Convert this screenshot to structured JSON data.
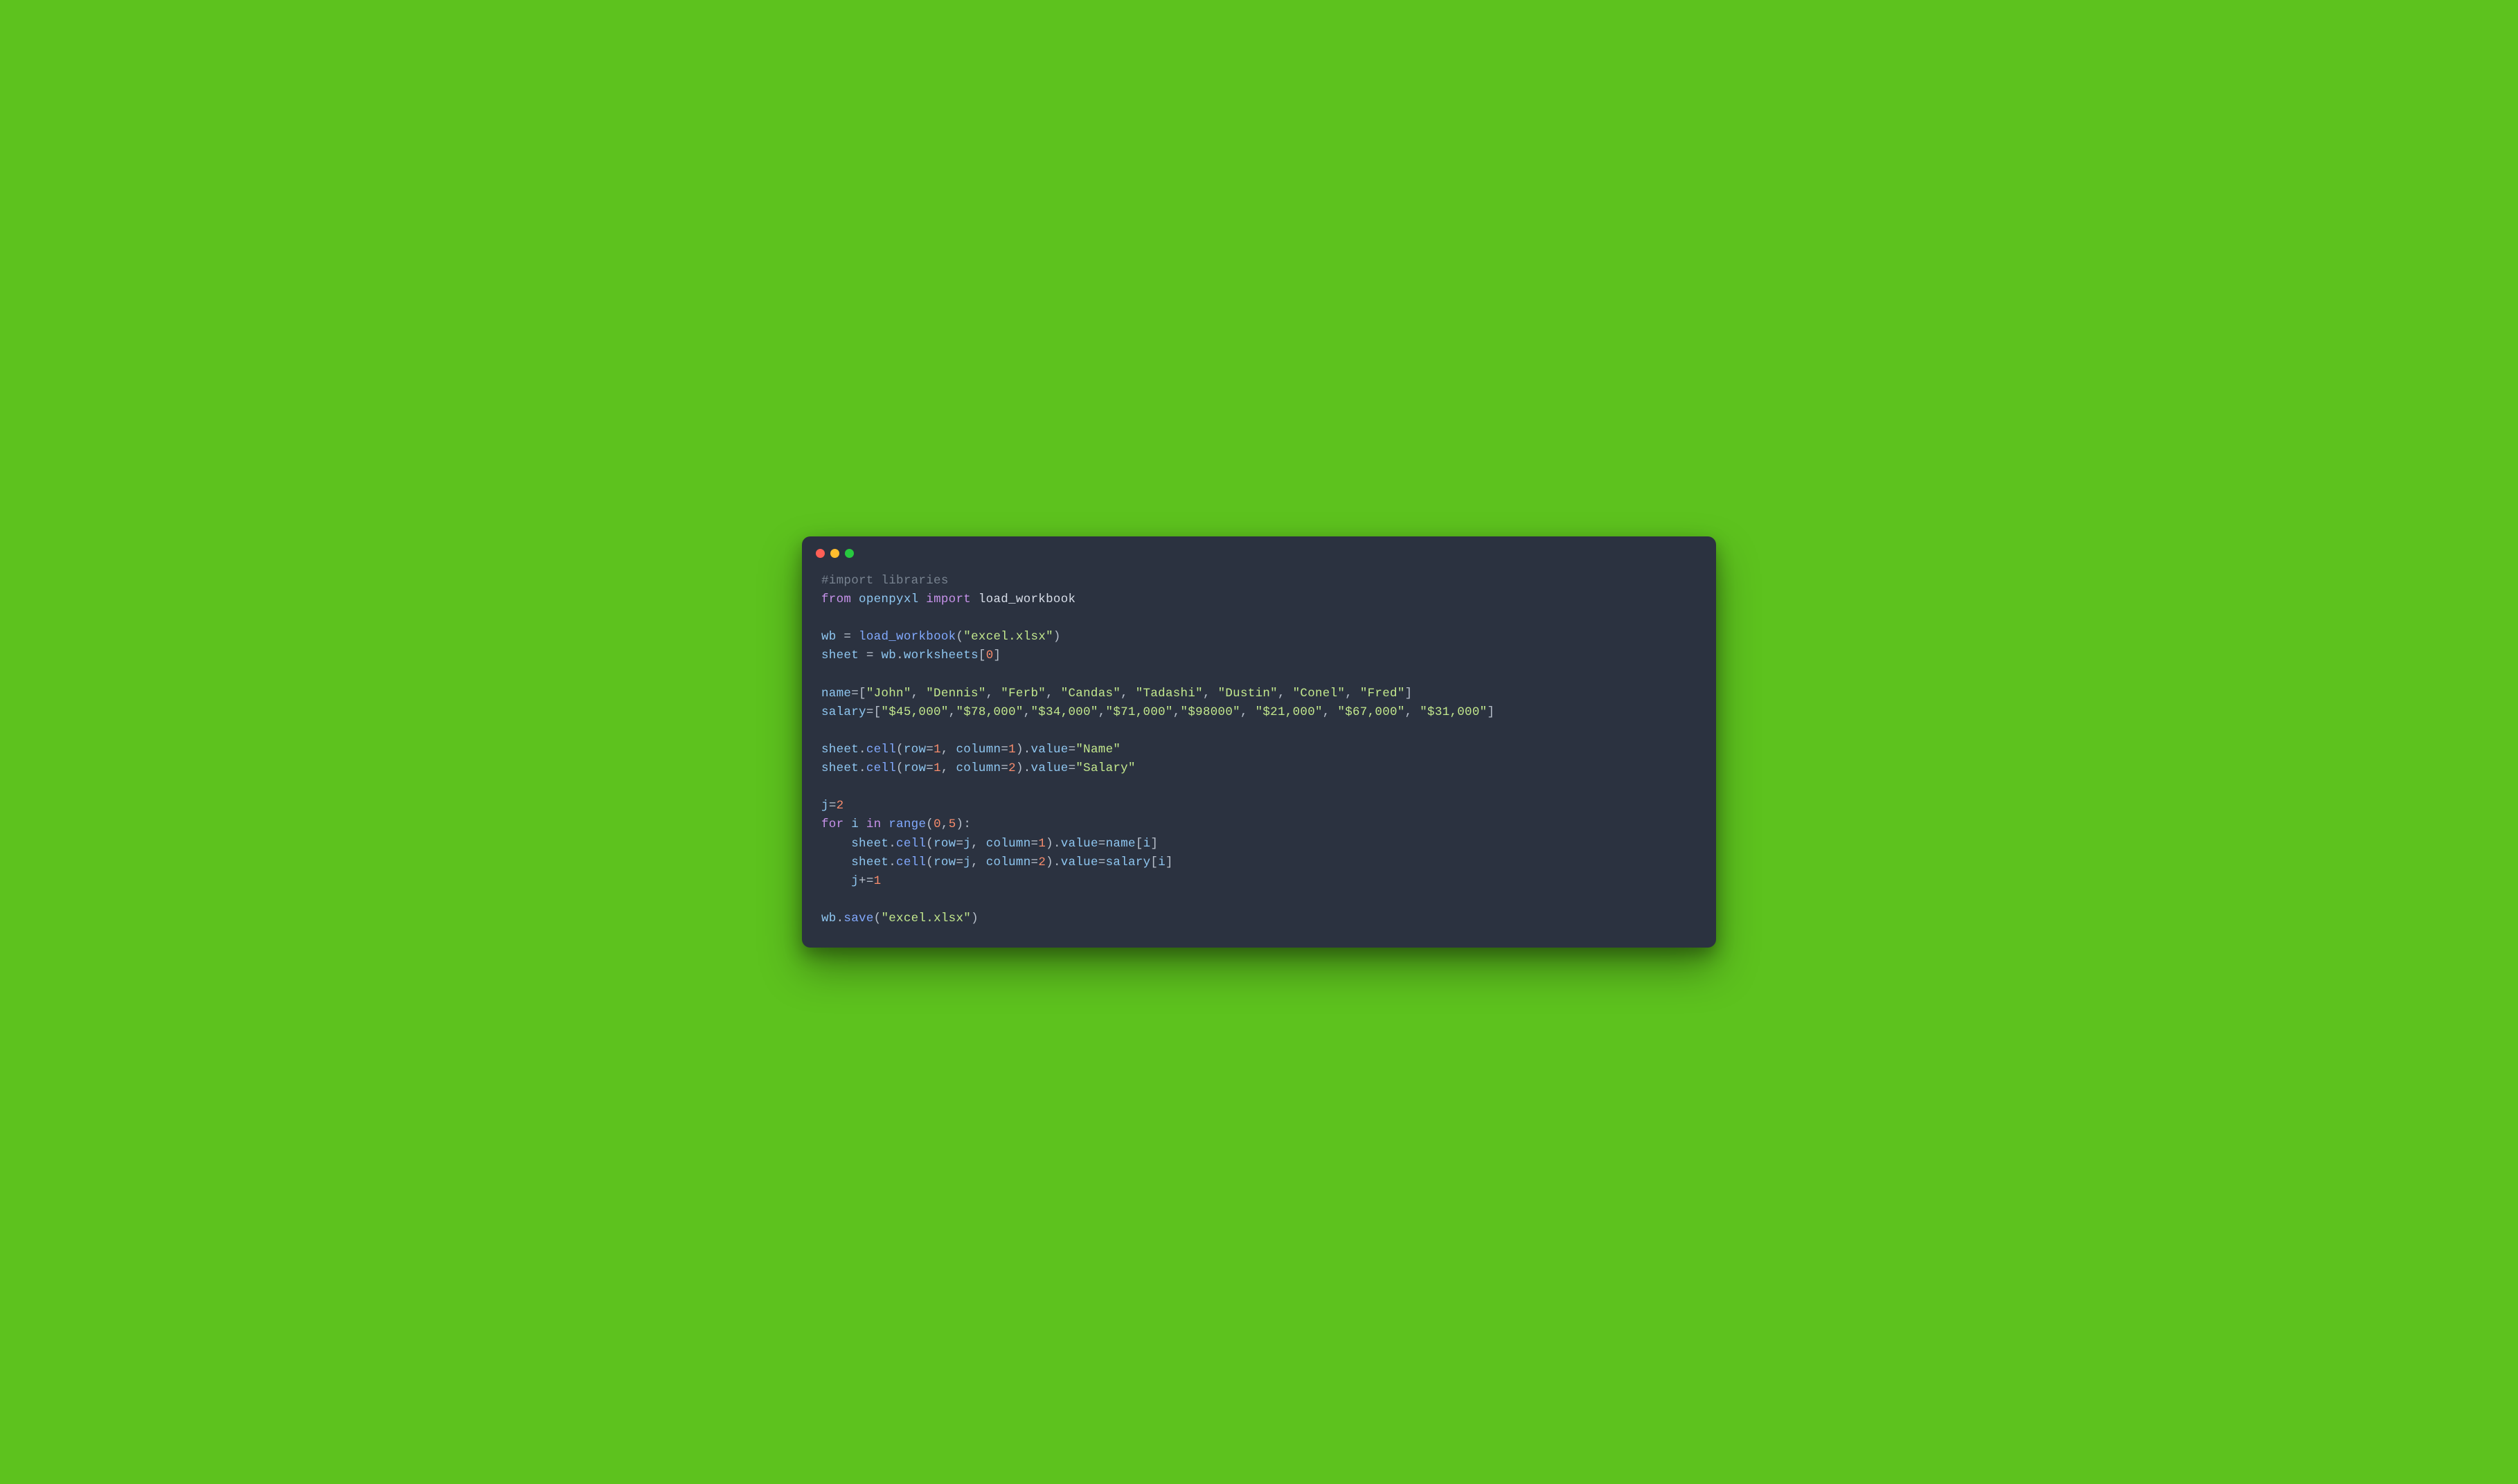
{
  "window": {
    "traffic_lights": [
      "red",
      "yellow",
      "green"
    ]
  },
  "code": {
    "lines": [
      [
        {
          "cls": "comment",
          "t": "#import libraries"
        }
      ],
      [
        {
          "cls": "keyword",
          "t": "from"
        },
        {
          "cls": "default",
          "t": " "
        },
        {
          "cls": "ident",
          "t": "openpyxl"
        },
        {
          "cls": "default",
          "t": " "
        },
        {
          "cls": "keyword",
          "t": "import"
        },
        {
          "cls": "default",
          "t": " load_workbook"
        }
      ],
      [],
      [
        {
          "cls": "ident",
          "t": "wb"
        },
        {
          "cls": "default",
          "t": " "
        },
        {
          "cls": "punct",
          "t": "="
        },
        {
          "cls": "default",
          "t": " "
        },
        {
          "cls": "func",
          "t": "load_workbook"
        },
        {
          "cls": "punct",
          "t": "("
        },
        {
          "cls": "string",
          "t": "\"excel.xlsx\""
        },
        {
          "cls": "punct",
          "t": ")"
        }
      ],
      [
        {
          "cls": "ident",
          "t": "sheet"
        },
        {
          "cls": "default",
          "t": " "
        },
        {
          "cls": "punct",
          "t": "="
        },
        {
          "cls": "default",
          "t": " "
        },
        {
          "cls": "ident",
          "t": "wb"
        },
        {
          "cls": "punct",
          "t": "."
        },
        {
          "cls": "prop",
          "t": "worksheets"
        },
        {
          "cls": "punct",
          "t": "["
        },
        {
          "cls": "number",
          "t": "0"
        },
        {
          "cls": "punct",
          "t": "]"
        }
      ],
      [],
      [
        {
          "cls": "ident",
          "t": "name"
        },
        {
          "cls": "punct",
          "t": "=["
        },
        {
          "cls": "string",
          "t": "\"John\""
        },
        {
          "cls": "punct",
          "t": ", "
        },
        {
          "cls": "string",
          "t": "\"Dennis\""
        },
        {
          "cls": "punct",
          "t": ", "
        },
        {
          "cls": "string",
          "t": "\"Ferb\""
        },
        {
          "cls": "punct",
          "t": ", "
        },
        {
          "cls": "string",
          "t": "\"Candas\""
        },
        {
          "cls": "punct",
          "t": ", "
        },
        {
          "cls": "string",
          "t": "\"Tadashi\""
        },
        {
          "cls": "punct",
          "t": ", "
        },
        {
          "cls": "string",
          "t": "\"Dustin\""
        },
        {
          "cls": "punct",
          "t": ", "
        },
        {
          "cls": "string",
          "t": "\"Conel\""
        },
        {
          "cls": "punct",
          "t": ", "
        },
        {
          "cls": "string",
          "t": "\"Fred\""
        },
        {
          "cls": "punct",
          "t": "]"
        }
      ],
      [
        {
          "cls": "ident",
          "t": "salary"
        },
        {
          "cls": "punct",
          "t": "=["
        },
        {
          "cls": "string",
          "t": "\"$45,000\""
        },
        {
          "cls": "punct",
          "t": ","
        },
        {
          "cls": "string",
          "t": "\"$78,000\""
        },
        {
          "cls": "punct",
          "t": ","
        },
        {
          "cls": "string",
          "t": "\"$34,000\""
        },
        {
          "cls": "punct",
          "t": ","
        },
        {
          "cls": "string",
          "t": "\"$71,000\""
        },
        {
          "cls": "punct",
          "t": ","
        },
        {
          "cls": "string",
          "t": "\"$98000\""
        },
        {
          "cls": "punct",
          "t": ", "
        },
        {
          "cls": "string",
          "t": "\"$21,000\""
        },
        {
          "cls": "punct",
          "t": ", "
        },
        {
          "cls": "string",
          "t": "\"$67,000\""
        },
        {
          "cls": "punct",
          "t": ", "
        },
        {
          "cls": "string",
          "t": "\"$31,000\""
        },
        {
          "cls": "punct",
          "t": "]"
        }
      ],
      [],
      [
        {
          "cls": "ident",
          "t": "sheet"
        },
        {
          "cls": "punct",
          "t": "."
        },
        {
          "cls": "func",
          "t": "cell"
        },
        {
          "cls": "punct",
          "t": "("
        },
        {
          "cls": "ident",
          "t": "row"
        },
        {
          "cls": "punct",
          "t": "="
        },
        {
          "cls": "number",
          "t": "1"
        },
        {
          "cls": "punct",
          "t": ", "
        },
        {
          "cls": "ident",
          "t": "column"
        },
        {
          "cls": "punct",
          "t": "="
        },
        {
          "cls": "number",
          "t": "1"
        },
        {
          "cls": "punct",
          "t": ")."
        },
        {
          "cls": "prop",
          "t": "value"
        },
        {
          "cls": "punct",
          "t": "="
        },
        {
          "cls": "string",
          "t": "\"Name\""
        }
      ],
      [
        {
          "cls": "ident",
          "t": "sheet"
        },
        {
          "cls": "punct",
          "t": "."
        },
        {
          "cls": "func",
          "t": "cell"
        },
        {
          "cls": "punct",
          "t": "("
        },
        {
          "cls": "ident",
          "t": "row"
        },
        {
          "cls": "punct",
          "t": "="
        },
        {
          "cls": "number",
          "t": "1"
        },
        {
          "cls": "punct",
          "t": ", "
        },
        {
          "cls": "ident",
          "t": "column"
        },
        {
          "cls": "punct",
          "t": "="
        },
        {
          "cls": "number",
          "t": "2"
        },
        {
          "cls": "punct",
          "t": ")."
        },
        {
          "cls": "prop",
          "t": "value"
        },
        {
          "cls": "punct",
          "t": "="
        },
        {
          "cls": "string",
          "t": "\"Salary\""
        }
      ],
      [],
      [
        {
          "cls": "ident",
          "t": "j"
        },
        {
          "cls": "punct",
          "t": "="
        },
        {
          "cls": "number",
          "t": "2"
        }
      ],
      [
        {
          "cls": "keyword",
          "t": "for"
        },
        {
          "cls": "default",
          "t": " "
        },
        {
          "cls": "ident",
          "t": "i"
        },
        {
          "cls": "default",
          "t": " "
        },
        {
          "cls": "keyword",
          "t": "in"
        },
        {
          "cls": "default",
          "t": " "
        },
        {
          "cls": "func",
          "t": "range"
        },
        {
          "cls": "punct",
          "t": "("
        },
        {
          "cls": "number",
          "t": "0"
        },
        {
          "cls": "punct",
          "t": ","
        },
        {
          "cls": "number",
          "t": "5"
        },
        {
          "cls": "punct",
          "t": "):"
        }
      ],
      [
        {
          "cls": "default",
          "t": "    "
        },
        {
          "cls": "ident",
          "t": "sheet"
        },
        {
          "cls": "punct",
          "t": "."
        },
        {
          "cls": "func",
          "t": "cell"
        },
        {
          "cls": "punct",
          "t": "("
        },
        {
          "cls": "ident",
          "t": "row"
        },
        {
          "cls": "punct",
          "t": "="
        },
        {
          "cls": "ident",
          "t": "j"
        },
        {
          "cls": "punct",
          "t": ", "
        },
        {
          "cls": "ident",
          "t": "column"
        },
        {
          "cls": "punct",
          "t": "="
        },
        {
          "cls": "number",
          "t": "1"
        },
        {
          "cls": "punct",
          "t": ")."
        },
        {
          "cls": "prop",
          "t": "value"
        },
        {
          "cls": "punct",
          "t": "="
        },
        {
          "cls": "ident",
          "t": "name"
        },
        {
          "cls": "punct",
          "t": "["
        },
        {
          "cls": "ident",
          "t": "i"
        },
        {
          "cls": "punct",
          "t": "]"
        }
      ],
      [
        {
          "cls": "default",
          "t": "    "
        },
        {
          "cls": "ident",
          "t": "sheet"
        },
        {
          "cls": "punct",
          "t": "."
        },
        {
          "cls": "func",
          "t": "cell"
        },
        {
          "cls": "punct",
          "t": "("
        },
        {
          "cls": "ident",
          "t": "row"
        },
        {
          "cls": "punct",
          "t": "="
        },
        {
          "cls": "ident",
          "t": "j"
        },
        {
          "cls": "punct",
          "t": ", "
        },
        {
          "cls": "ident",
          "t": "column"
        },
        {
          "cls": "punct",
          "t": "="
        },
        {
          "cls": "number",
          "t": "2"
        },
        {
          "cls": "punct",
          "t": ")."
        },
        {
          "cls": "prop",
          "t": "value"
        },
        {
          "cls": "punct",
          "t": "="
        },
        {
          "cls": "ident",
          "t": "salary"
        },
        {
          "cls": "punct",
          "t": "["
        },
        {
          "cls": "ident",
          "t": "i"
        },
        {
          "cls": "punct",
          "t": "]"
        }
      ],
      [
        {
          "cls": "default",
          "t": "    "
        },
        {
          "cls": "ident",
          "t": "j"
        },
        {
          "cls": "punct",
          "t": "+="
        },
        {
          "cls": "number",
          "t": "1"
        }
      ],
      [],
      [
        {
          "cls": "ident",
          "t": "wb"
        },
        {
          "cls": "punct",
          "t": "."
        },
        {
          "cls": "func",
          "t": "save"
        },
        {
          "cls": "punct",
          "t": "("
        },
        {
          "cls": "string",
          "t": "\"excel.xlsx\""
        },
        {
          "cls": "punct",
          "t": ")"
        }
      ]
    ]
  }
}
